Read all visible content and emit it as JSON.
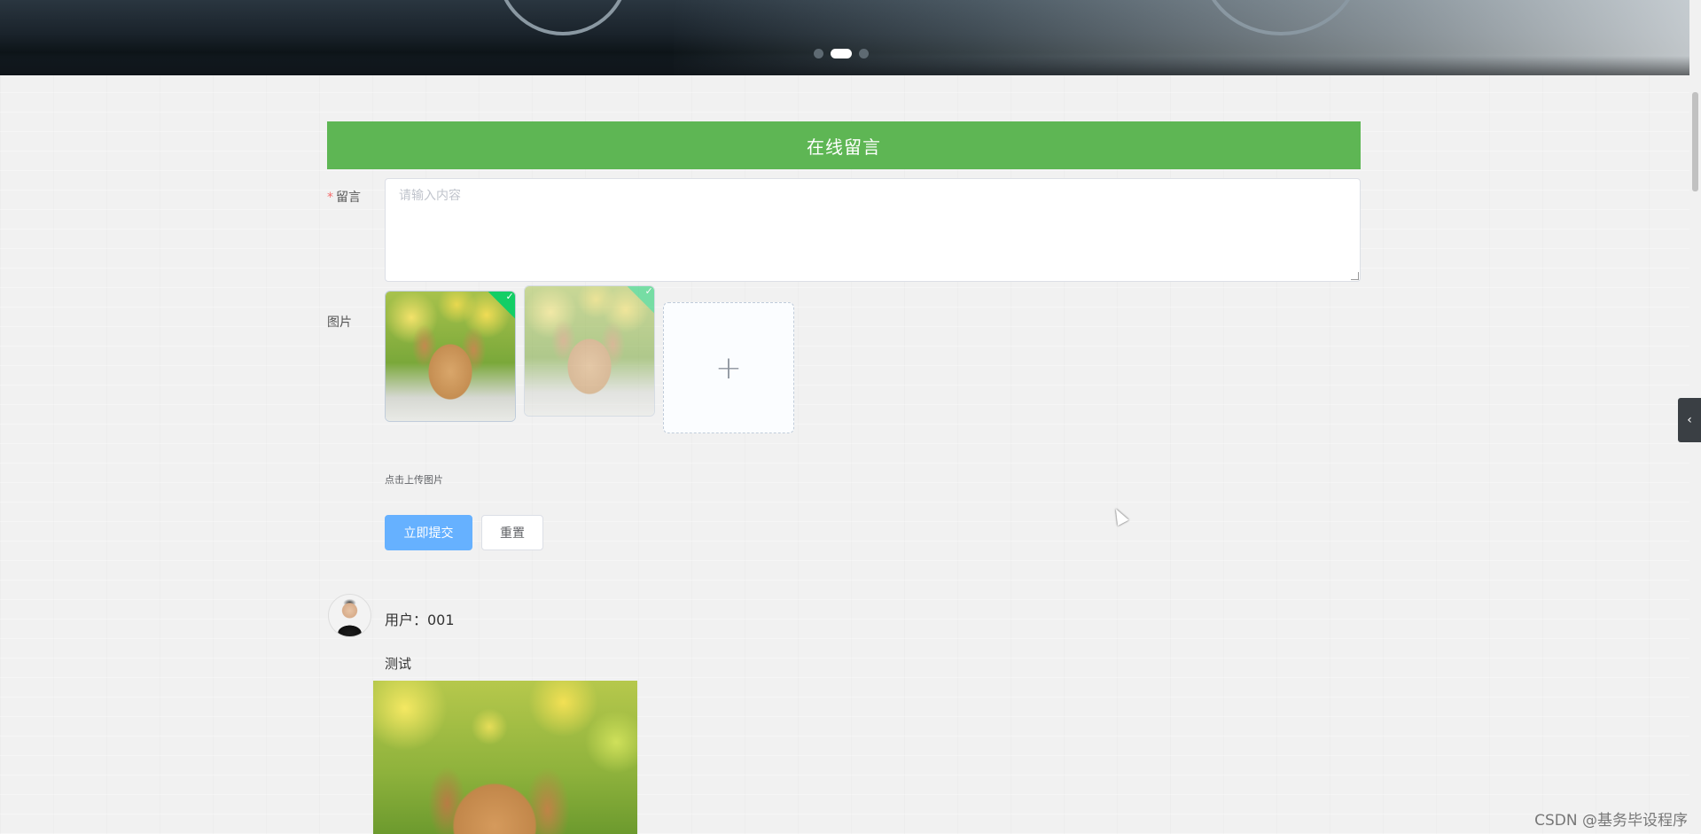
{
  "carousel": {
    "slides": 3,
    "active_index": 1
  },
  "form": {
    "title": "在线留言",
    "message_label": "留言",
    "required_mark": "*",
    "message_placeholder": "请输入内容",
    "message_value": "",
    "image_label": "图片",
    "uploaded_images": [
      "bunny-photo",
      "bunny-photo"
    ],
    "upload_plus": "+",
    "upload_tip": "点击上传图片",
    "submit_label": "立即提交",
    "reset_label": "重置"
  },
  "comments": [
    {
      "user": "用户：001",
      "text": "测试",
      "image": "bunny-photo"
    }
  ],
  "sidebar_toggle_icon": "‹",
  "watermark": "CSDN @基务毕设程序",
  "colors": {
    "section_header": "#5eb654",
    "primary_button": "#66b1ff",
    "upload_success": "#13ce66",
    "required": "#f56c6c"
  }
}
